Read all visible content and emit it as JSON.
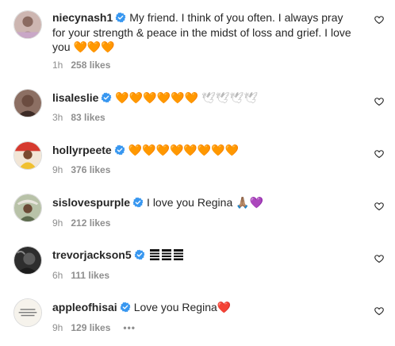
{
  "comments": [
    {
      "username": "niecynash1",
      "text": "My friend. I think of you often. I always pray for your strength & peace in the midst of loss and grief. I love you",
      "emoji": "🧡🧡🧡",
      "time": "1h",
      "likes": "258 likes",
      "avatar_color": "#a88a86"
    },
    {
      "username": "lisaleslie",
      "text": "",
      "emoji": "🧡🧡🧡🧡🧡🧡",
      "emoji2": "🕊🕊🕊🕊",
      "time": "3h",
      "likes": "83 likes",
      "avatar_color": "#5a4640"
    },
    {
      "username": "hollyrpeete",
      "text": "",
      "emoji": "🧡🧡🧡🧡🧡🧡🧡🧡",
      "time": "9h",
      "likes": "376 likes",
      "avatar_color": "#e0a43a"
    },
    {
      "username": "sislovespurple",
      "text": "I love you Regina",
      "emoji": "🙏🏽",
      "emoji2": "💜",
      "time": "9h",
      "likes": "212 likes",
      "avatar_color": "#8a9a7a"
    },
    {
      "username": "trevorjackson5",
      "text": "",
      "time": "6h",
      "likes": "111 likes",
      "avatar_color": "#4a4a4a"
    },
    {
      "username": "appleofhisai",
      "text": "Love you Regina",
      "emoji": "❤️",
      "time": "9h",
      "likes": "129 likes",
      "more": "•••",
      "avatar_color": "#f4f1ea"
    }
  ],
  "colors": {
    "verified": "#3897f0",
    "meta_text": "#8e8e8e",
    "body_text": "#262626"
  },
  "icons": {
    "verified": "verified-badge-icon",
    "like": "heart-outline-icon"
  }
}
